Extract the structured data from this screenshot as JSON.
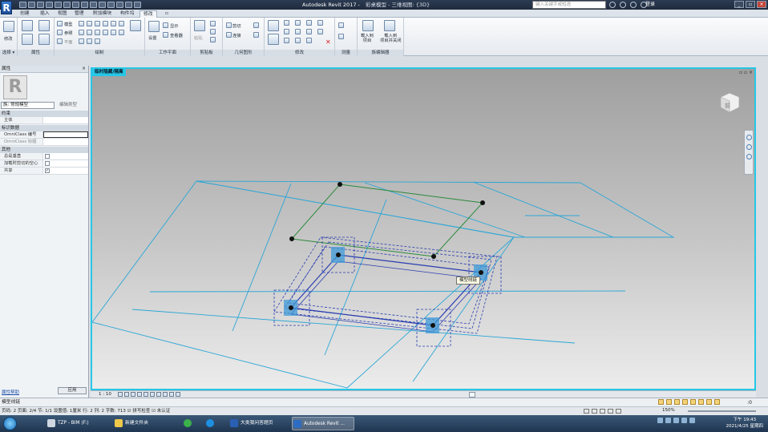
{
  "app": {
    "logo": "R",
    "title": "Autodesk Revit 2017 -",
    "document": "彩桌模型 - 三维视图: {3D}",
    "search_placeholder": "键入关键字或短语",
    "login": "登录"
  },
  "tabs": [
    "创建",
    "插入",
    "视图",
    "管理",
    "附加模块",
    "构件坞",
    "修改",
    "▫"
  ],
  "active_tab": "修改",
  "ribbon": {
    "panels": [
      "选择",
      "属性",
      "绘制",
      "工作平面",
      "剪贴板",
      "几何图形",
      "修改",
      "测量",
      "族编辑器"
    ],
    "buttons": {
      "modify": "修改",
      "model": "模型",
      "reference": "参照",
      "plane": "平面",
      "set": "设置",
      "show": "显示",
      "viewer": "查看器",
      "paste": "粘贴",
      "cut": "剪切",
      "join": "连接",
      "load_project": "载入到\n项目",
      "load_close": "载入到\n项目并关闭"
    },
    "select_dropdown": "选择 ▾"
  },
  "properties": {
    "header": "属性",
    "type": "族: 常规模型",
    "edit_type": "编辑类型",
    "sections": [
      {
        "name": "约束",
        "rows": [
          {
            "k": "主体",
            "v": ""
          }
        ]
      },
      {
        "name": "标识数据",
        "rows": [
          {
            "k": "OmniClass 编号",
            "v": ""
          },
          {
            "k": "OmniClass 标题",
            "v": ""
          }
        ]
      },
      {
        "name": "其他",
        "rows": [
          {
            "k": "总是垂直",
            "check": false
          },
          {
            "k": "加载时剪切的空心",
            "check": false
          },
          {
            "k": "共享",
            "check": true
          }
        ]
      }
    ],
    "help": "属性帮助",
    "apply": "应用"
  },
  "view": {
    "tab": "临时隐藏/隔离",
    "tooltip": "模型线链",
    "scale": "1 : 10",
    "cube": "前"
  },
  "status": {
    "text": "模型线链",
    "zero": ":0"
  },
  "status2": {
    "left": "页码: 2  页面: 2/4  节: 1/1  设置值: 1厘米  行: 2  列: 2  字数: 713  ☑ 拼写检查  ☑ 未认证",
    "zoom": "150%"
  },
  "taskbar": {
    "items": [
      "TZP - BIM (F:)",
      "新建文件夹",
      "",
      "",
      "大类我问答题页",
      "Autodesk Revit ..."
    ],
    "time": "下午 19:43",
    "date": "2021/4/25 星期四"
  },
  "colors": {
    "accent": "#26c7e6",
    "grid": "#2aa6d6",
    "model": "#1a2f9a",
    "sketch": "#2b8a3b"
  }
}
